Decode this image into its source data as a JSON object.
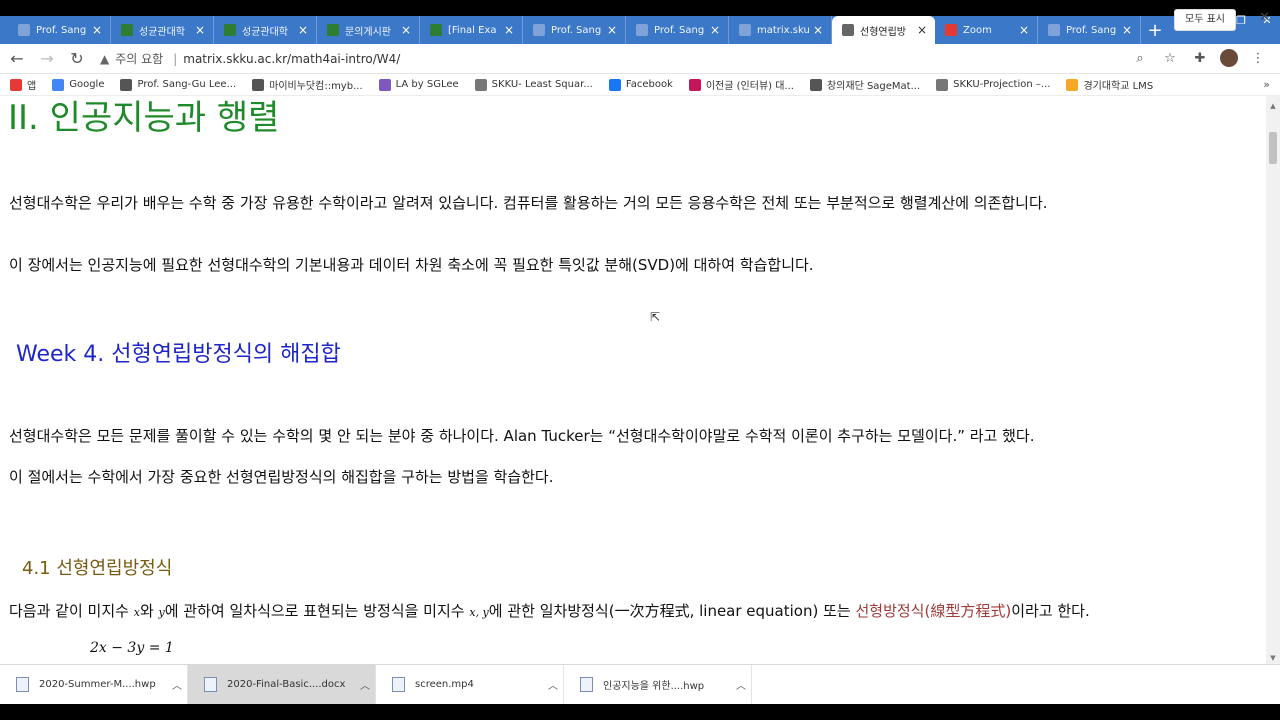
{
  "tabs": [
    {
      "label": "Prof. Sang",
      "active": false,
      "icon_color": "#7fa3d9"
    },
    {
      "label": "성균관대학",
      "active": false,
      "icon_color": "#2e7d32"
    },
    {
      "label": "성균관대학",
      "active": false,
      "icon_color": "#2e7d32"
    },
    {
      "label": "문의게시판",
      "active": false,
      "icon_color": "#2e7d32"
    },
    {
      "label": "[Final Exa",
      "active": false,
      "icon_color": "#2e7d32"
    },
    {
      "label": "Prof. Sang",
      "active": false,
      "icon_color": "#7fa3d9"
    },
    {
      "label": "Prof. Sang",
      "active": false,
      "icon_color": "#7fa3d9"
    },
    {
      "label": "matrix.sku",
      "active": false,
      "icon_color": "#7fa3d9"
    },
    {
      "label": "선형연립방",
      "active": true,
      "icon_color": "#666666"
    },
    {
      "label": "Zoom",
      "active": false,
      "icon_color": "#e53935"
    },
    {
      "label": "Prof. Sang",
      "active": false,
      "icon_color": "#7fa3d9"
    }
  ],
  "toolbar": {
    "insecure_label": "주의 요함",
    "url": "matrix.skku.ac.kr/math4ai-intro/W4/"
  },
  "bookmarks": [
    {
      "label": "앱",
      "icon_color": "#e53935"
    },
    {
      "label": "Google",
      "icon_color": "#4285f4"
    },
    {
      "label": "Prof. Sang-Gu Lee...",
      "icon_color": "#555555"
    },
    {
      "label": "마이비누닷컴::myb...",
      "icon_color": "#555555"
    },
    {
      "label": "LA by SGLee",
      "icon_color": "#7e57c2"
    },
    {
      "label": "SKKU- Least Squar...",
      "icon_color": "#777777"
    },
    {
      "label": "Facebook",
      "icon_color": "#1877f2"
    },
    {
      "label": "이전글 (인터뷰) 대...",
      "icon_color": "#c2185b"
    },
    {
      "label": "창의재단 SageMat...",
      "icon_color": "#555555"
    },
    {
      "label": "SKKU-Projection –...",
      "icon_color": "#777777"
    },
    {
      "label": "경기대학교 LMS",
      "icon_color": "#f9a825"
    }
  ],
  "content": {
    "chapter_title": "II.   인공지능과 행렬",
    "intro_para1": "선형대수학은 우리가 배우는 수학 중 가장 유용한 수학이라고 알려져 있습니다. 컴퓨터를 활용하는 거의 모든 응용수학은 전체 또는 부분적으로 행렬계산에 의존합니다.",
    "intro_para2": "이 장에서는 인공지능에 필요한 선형대수학의 기본내용과 데이터 차원 축소에 꼭 필요한 특잇값 분해(SVD)에 대하여 학습합니다.",
    "week_title": "Week 4.  선형연립방정식의 해집합",
    "week_para1": "선형대수학은 모든 문제를 풀이할 수 있는 수학의 몇 안 되는 분야 중 하나이다. Alan Tucker는 “선형대수학이야말로 수학적 이론이 추구하는 모델이다.” 라고 했다.",
    "week_para2": "이 절에서는 수학에서 가장 중요한 선형연립방정식의 해집합을 구하는 방법을 학습한다.",
    "section_title": "4.1 선형연립방정식",
    "def_pre": "다음과 같이 미지수 ",
    "def_x": "x",
    "def_and": "와 ",
    "def_y": "y",
    "def_mid": "에 관하여 일차식으로 표현되는 방정식을 미지수 ",
    "def_xy": "x, y",
    "def_mid2": "에 관한 일차방정식(一次方程式, linear equation) 또는 ",
    "def_term": "선형방정식(線型方程式)",
    "def_post": "이라고 한다.",
    "equation": "2x − 3y = 1"
  },
  "downloads": [
    {
      "name": "2020-Summer-M....hwp",
      "highlighted": false
    },
    {
      "name": "2020-Final-Basic....docx",
      "highlighted": true
    },
    {
      "name": "screen.mp4",
      "highlighted": false
    },
    {
      "name": "인공지능을 위한....hwp",
      "highlighted": false
    }
  ],
  "downloads_bar": {
    "show_all_label": "모두 표시"
  }
}
